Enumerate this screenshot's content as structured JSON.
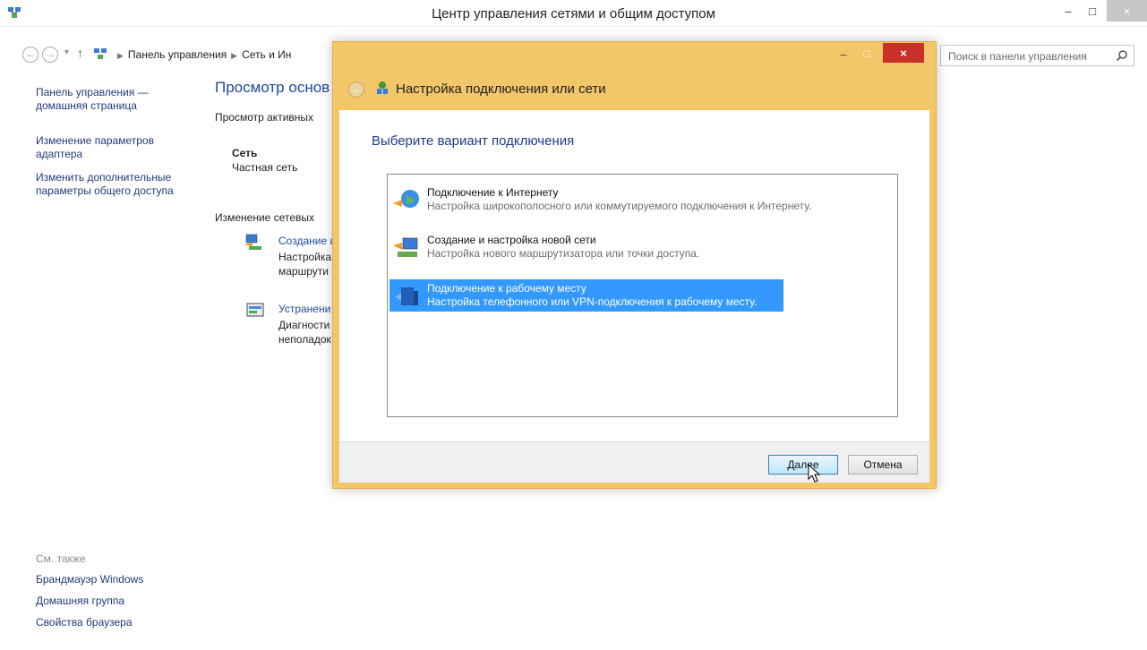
{
  "window": {
    "title": "Центр управления сетями и общим доступом",
    "controls": {
      "minimize": "–",
      "maximize": "□",
      "close": "×"
    }
  },
  "navbar": {
    "back": "←",
    "forward": "→",
    "up": "↑",
    "breadcrumb": [
      "Панель управления",
      "Сеть и Ин"
    ],
    "search_placeholder": "Поиск в панели управления"
  },
  "sidebar": {
    "items": [
      "Панель управления —",
      "домашняя страница",
      "Изменение параметров",
      "адаптера",
      "Изменить дополнительные",
      "параметры общего доступа"
    ],
    "see_also": {
      "label": "См. также",
      "items": [
        "Брандмауэр Windows",
        "Домашняя группа",
        "Свойства браузера"
      ]
    }
  },
  "main": {
    "title": "Просмотр основ",
    "active_networks": "Просмотр активных",
    "network_name": "Сеть",
    "network_type": "Частная сеть",
    "change_settings": "Изменение сетевых",
    "tasks": [
      {
        "link": "Создание и",
        "desc1": "Настройка",
        "desc2": "маршрути",
        "icon": "network-setup-icon"
      },
      {
        "link": "Устранени",
        "desc1": "Диагности",
        "desc2": "неполадок",
        "icon": "troubleshoot-icon"
      }
    ]
  },
  "dialog": {
    "title": "Настройка подключения или сети",
    "heading": "Выберите вариант подключения",
    "controls": {
      "minimize": "–",
      "maximize": "□",
      "close": "×"
    },
    "options": [
      {
        "title": "Подключение к Интернету",
        "desc": "Настройка широкополосного или коммутируемого подключения к Интернету.",
        "selected": false,
        "icon": "globe-icon"
      },
      {
        "title": "Создание и настройка новой сети",
        "desc": "Настройка нового маршрутизатора или точки доступа.",
        "selected": false,
        "icon": "router-icon"
      },
      {
        "title": "Подключение к рабочему месту",
        "desc": "Настройка телефонного или VPN-подключения к рабочему месту.",
        "selected": true,
        "icon": "workplace-icon"
      }
    ],
    "buttons": {
      "next": "Далее",
      "cancel": "Отмена"
    }
  },
  "colors": {
    "dialog_frame": "#f3c66a",
    "selection": "#3399ff",
    "link": "#1e4a9a",
    "close_red": "#c8302a"
  }
}
